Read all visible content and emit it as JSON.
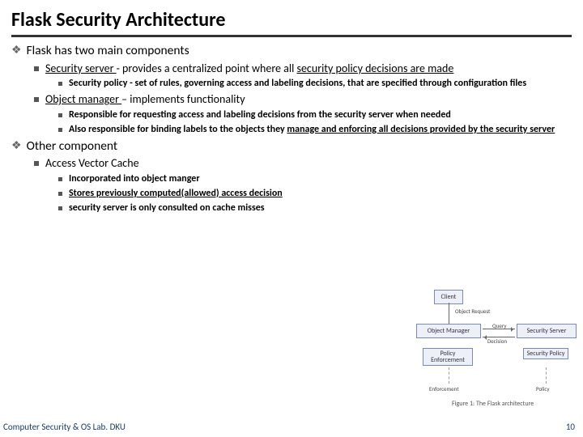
{
  "title": "Flask Security Architecture",
  "l1a": "Flask has two main components",
  "l2a_pre": "Security server ",
  "l2a_post": "- provides a centralized point where all ",
  "l2a_u2": "security policy decisions are made",
  "l3a": "Security policy  - set of rules, governing access and labeling decisions, that are specified through configuration files",
  "l2b_pre": "Object manager ",
  "l2b_post": "– implements functionality",
  "l3b": "Responsible for requesting access and labeling decisions from the security server when needed",
  "l3c_pre": "Also responsible for binding labels to the objects they ",
  "l3c_u": "manage and enforcing all decisions provided by the security server",
  "l1b": "Other component",
  "l2c": "Access Vector Cache",
  "l3d": "Incorporated into object manger",
  "l3e": "Stores previously computed(allowed) access decision",
  "l3f": "security server is only consulted on cache misses",
  "footer_left": "Computer Security & OS Lab. DKU",
  "footer_right": "10",
  "diag": {
    "client": "Client",
    "om": "Object Manager",
    "ss": "Security Server",
    "pe": "Policy Enforcement",
    "sp": "Security Policy",
    "ar_req": "Object Request",
    "ar_query": "Query",
    "ar_decision": "Decision",
    "enforcement": "Enforcement",
    "policy": "Policy",
    "caption": "Figure 1: The Flask architecture"
  }
}
